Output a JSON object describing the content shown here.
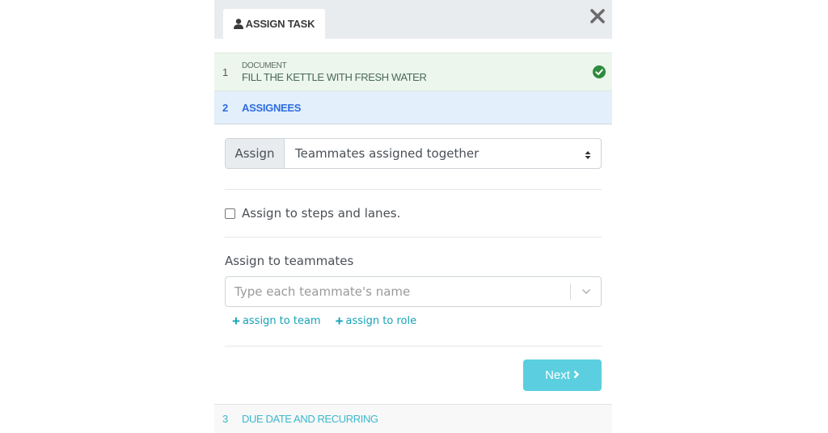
{
  "header": {
    "tab_label": "ASSIGN TASK",
    "tab_icon": "user-icon",
    "close_icon": "close-icon"
  },
  "steps": [
    {
      "number": "1",
      "sublabel": "DOCUMENT",
      "label": "FILL THE KETTLE WITH FRESH WATER",
      "status": "complete",
      "status_icon": "check-circle-icon"
    },
    {
      "number": "2",
      "label": "ASSIGNEES",
      "status": "active"
    },
    {
      "number": "3",
      "label": "DUE DATE AND RECURRING",
      "status": "pending"
    }
  ],
  "assign": {
    "addon_label": "Assign",
    "selected": "Teammates assigned together"
  },
  "checkbox": {
    "label": "Assign to steps and lanes.",
    "checked": false
  },
  "teammates": {
    "label": "Assign to teammates",
    "placeholder": "Type each teammate's name",
    "value": ""
  },
  "links": {
    "assign_team": "assign to team",
    "assign_role": "assign to role"
  },
  "next_button": {
    "label": "Next",
    "chevron": "›"
  },
  "colors": {
    "accent": "#5bcfdf",
    "link": "#17a2b8",
    "active_step": "#2e6de0",
    "complete_step_bg": "#ecf6ed",
    "success": "#2e8b3d"
  }
}
